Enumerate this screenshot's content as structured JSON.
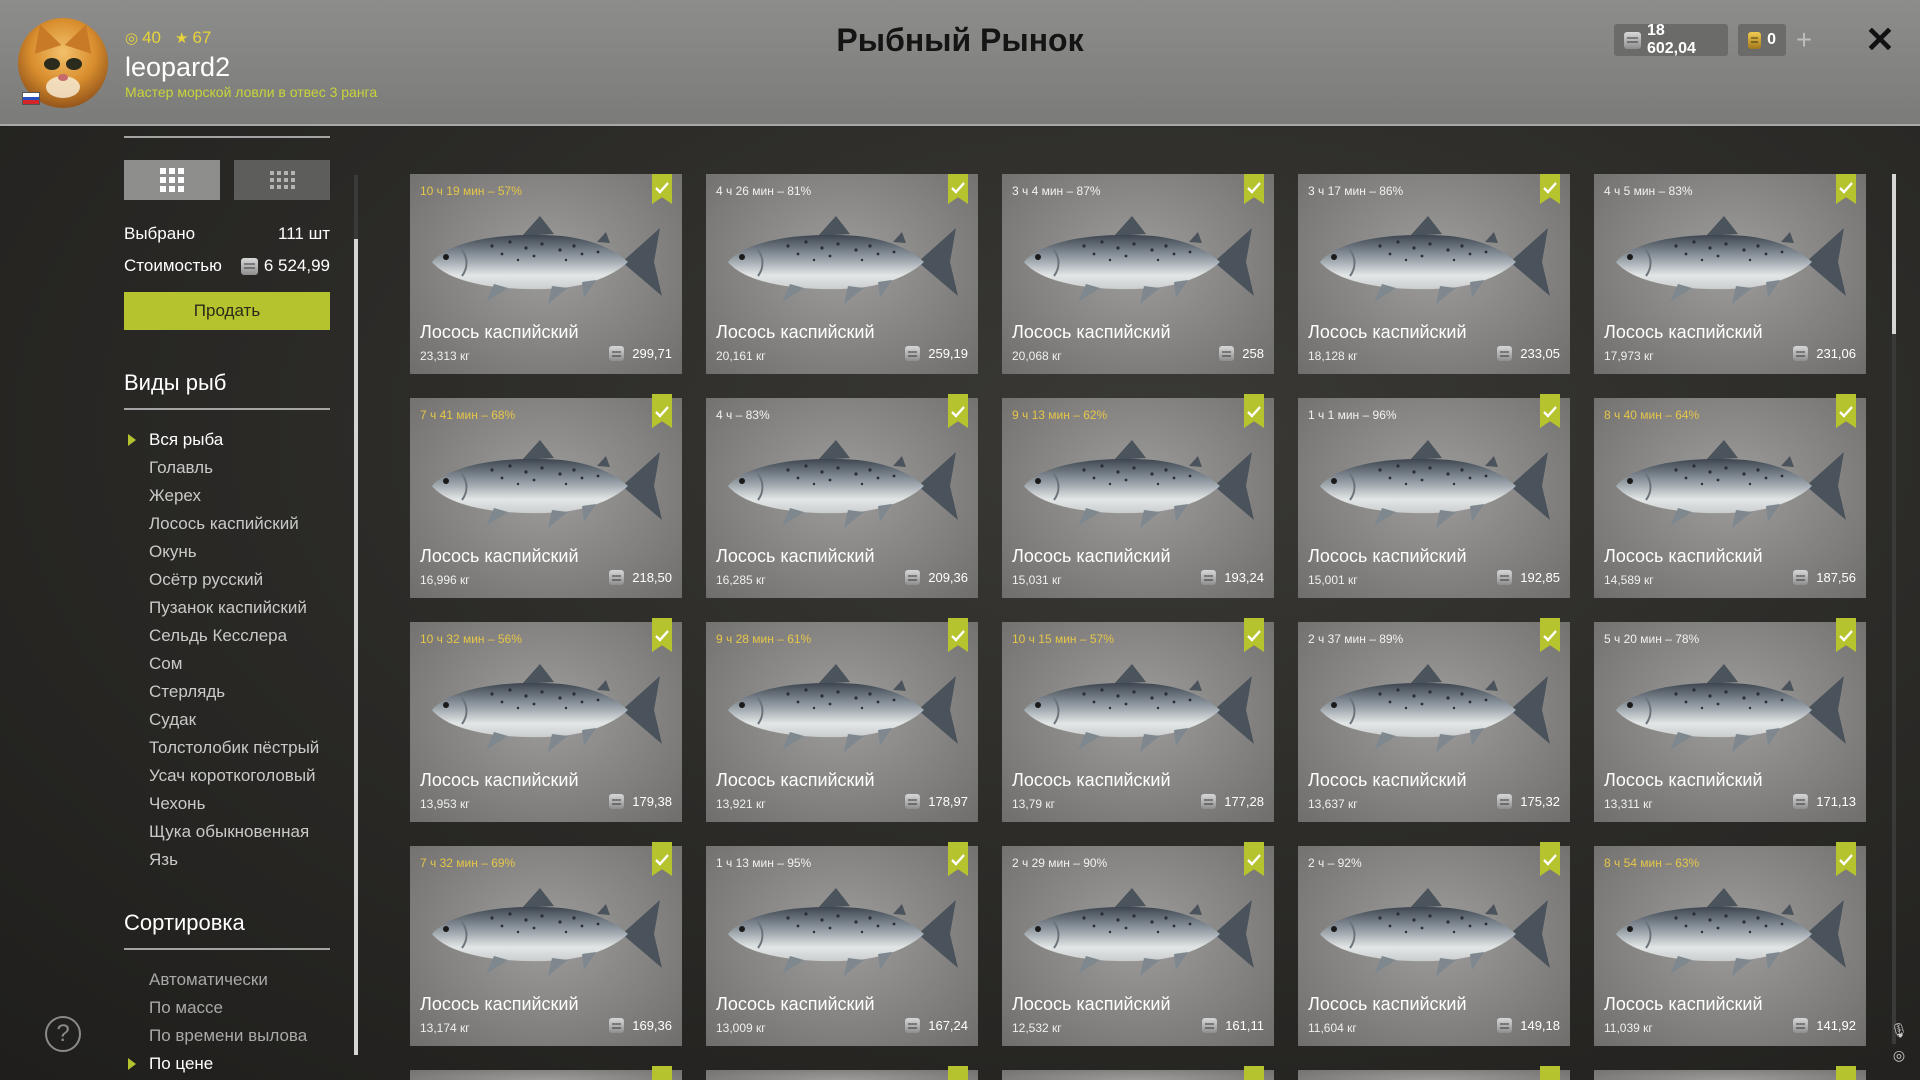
{
  "header": {
    "title": "Рыбный Рынок",
    "player": {
      "level_a": "40",
      "level_b": "67",
      "username": "leopard2",
      "rank": "Мастер морской ловли в отвес 3 ранга"
    },
    "currency": {
      "silver": "18 602,04",
      "gold": "0"
    },
    "icons": {
      "add": "plus-icon",
      "close": "close-icon"
    }
  },
  "left_panel": {
    "view_modes": [
      "grid-large-icon",
      "grid-small-icon"
    ],
    "selected_label": "Выбрано",
    "selected_value": "111 шт",
    "cost_label": "Стоимостью",
    "cost_value": "6 524,99",
    "sell_button": "Продать",
    "species_title": "Виды рыб",
    "species": [
      "Вся рыба",
      "Голавль",
      "Жерех",
      "Лосось каспийский",
      "Окунь",
      "Осётр русский",
      "Пузанок каспийский",
      "Сельдь Кесслера",
      "Сом",
      "Стерлядь",
      "Судак",
      "Толстолобик пёстрый",
      "Усач короткоголовый",
      "Чехонь",
      "Щука обыкновенная",
      "Язь"
    ],
    "species_selected": "Вся рыба",
    "sort_title": "Сортировка",
    "sort_options": [
      "Автоматически",
      "По массе",
      "По времени вылова",
      "По цене"
    ],
    "sort_selected": "По цене"
  },
  "fish_cards": [
    {
      "timer": "10 ч 19 мин – 57%",
      "warn": true,
      "name": "Лосось каспийский",
      "weight": "23,313 кг",
      "price": "299,71"
    },
    {
      "timer": "4 ч 26 мин – 81%",
      "warn": false,
      "name": "Лосось каспийский",
      "weight": "20,161 кг",
      "price": "259,19"
    },
    {
      "timer": "3 ч 4 мин – 87%",
      "warn": false,
      "name": "Лосось каспийский",
      "weight": "20,068 кг",
      "price": "258"
    },
    {
      "timer": "3 ч 17 мин – 86%",
      "warn": false,
      "name": "Лосось каспийский",
      "weight": "18,128 кг",
      "price": "233,05"
    },
    {
      "timer": "4 ч 5 мин – 83%",
      "warn": false,
      "name": "Лосось каспийский",
      "weight": "17,973 кг",
      "price": "231,06"
    },
    {
      "timer": "7 ч 41 мин – 68%",
      "warn": true,
      "name": "Лосось каспийский",
      "weight": "16,996 кг",
      "price": "218,50"
    },
    {
      "timer": "4 ч – 83%",
      "warn": false,
      "name": "Лосось каспийский",
      "weight": "16,285 кг",
      "price": "209,36"
    },
    {
      "timer": "9 ч 13 мин – 62%",
      "warn": true,
      "name": "Лосось каспийский",
      "weight": "15,031 кг",
      "price": "193,24"
    },
    {
      "timer": "1 ч 1 мин – 96%",
      "warn": false,
      "name": "Лосось каспийский",
      "weight": "15,001 кг",
      "price": "192,85"
    },
    {
      "timer": "8 ч 40 мин – 64%",
      "warn": true,
      "name": "Лосось каспийский",
      "weight": "14,589 кг",
      "price": "187,56"
    },
    {
      "timer": "10 ч 32 мин – 56%",
      "warn": true,
      "name": "Лосось каспийский",
      "weight": "13,953 кг",
      "price": "179,38"
    },
    {
      "timer": "9 ч 28 мин – 61%",
      "warn": true,
      "name": "Лосось каспийский",
      "weight": "13,921 кг",
      "price": "178,97"
    },
    {
      "timer": "10 ч 15 мин – 57%",
      "warn": true,
      "name": "Лосось каспийский",
      "weight": "13,79 кг",
      "price": "177,28"
    },
    {
      "timer": "2 ч 37 мин – 89%",
      "warn": false,
      "name": "Лосось каспийский",
      "weight": "13,637 кг",
      "price": "175,32"
    },
    {
      "timer": "5 ч 20 мин – 78%",
      "warn": false,
      "name": "Лосось каспийский",
      "weight": "13,311 кг",
      "price": "171,13"
    },
    {
      "timer": "7 ч 32 мин – 69%",
      "warn": true,
      "name": "Лосось каспийский",
      "weight": "13,174 кг",
      "price": "169,36"
    },
    {
      "timer": "1 ч 13 мин – 95%",
      "warn": false,
      "name": "Лосось каспийский",
      "weight": "13,009 кг",
      "price": "167,24"
    },
    {
      "timer": "2 ч 29 мин – 90%",
      "warn": false,
      "name": "Лосось каспийский",
      "weight": "12,532 кг",
      "price": "161,11"
    },
    {
      "timer": "2 ч – 92%",
      "warn": false,
      "name": "Лосось каспийский",
      "weight": "11,604 кг",
      "price": "149,18"
    },
    {
      "timer": "8 ч 54 мин – 63%",
      "warn": true,
      "name": "Лосось каспийский",
      "weight": "11,039 кг",
      "price": "141,92"
    }
  ],
  "colors": {
    "accent": "#b5c42e",
    "warn_timer": "#e6c64a",
    "header_bg": "#8d8d8b"
  }
}
